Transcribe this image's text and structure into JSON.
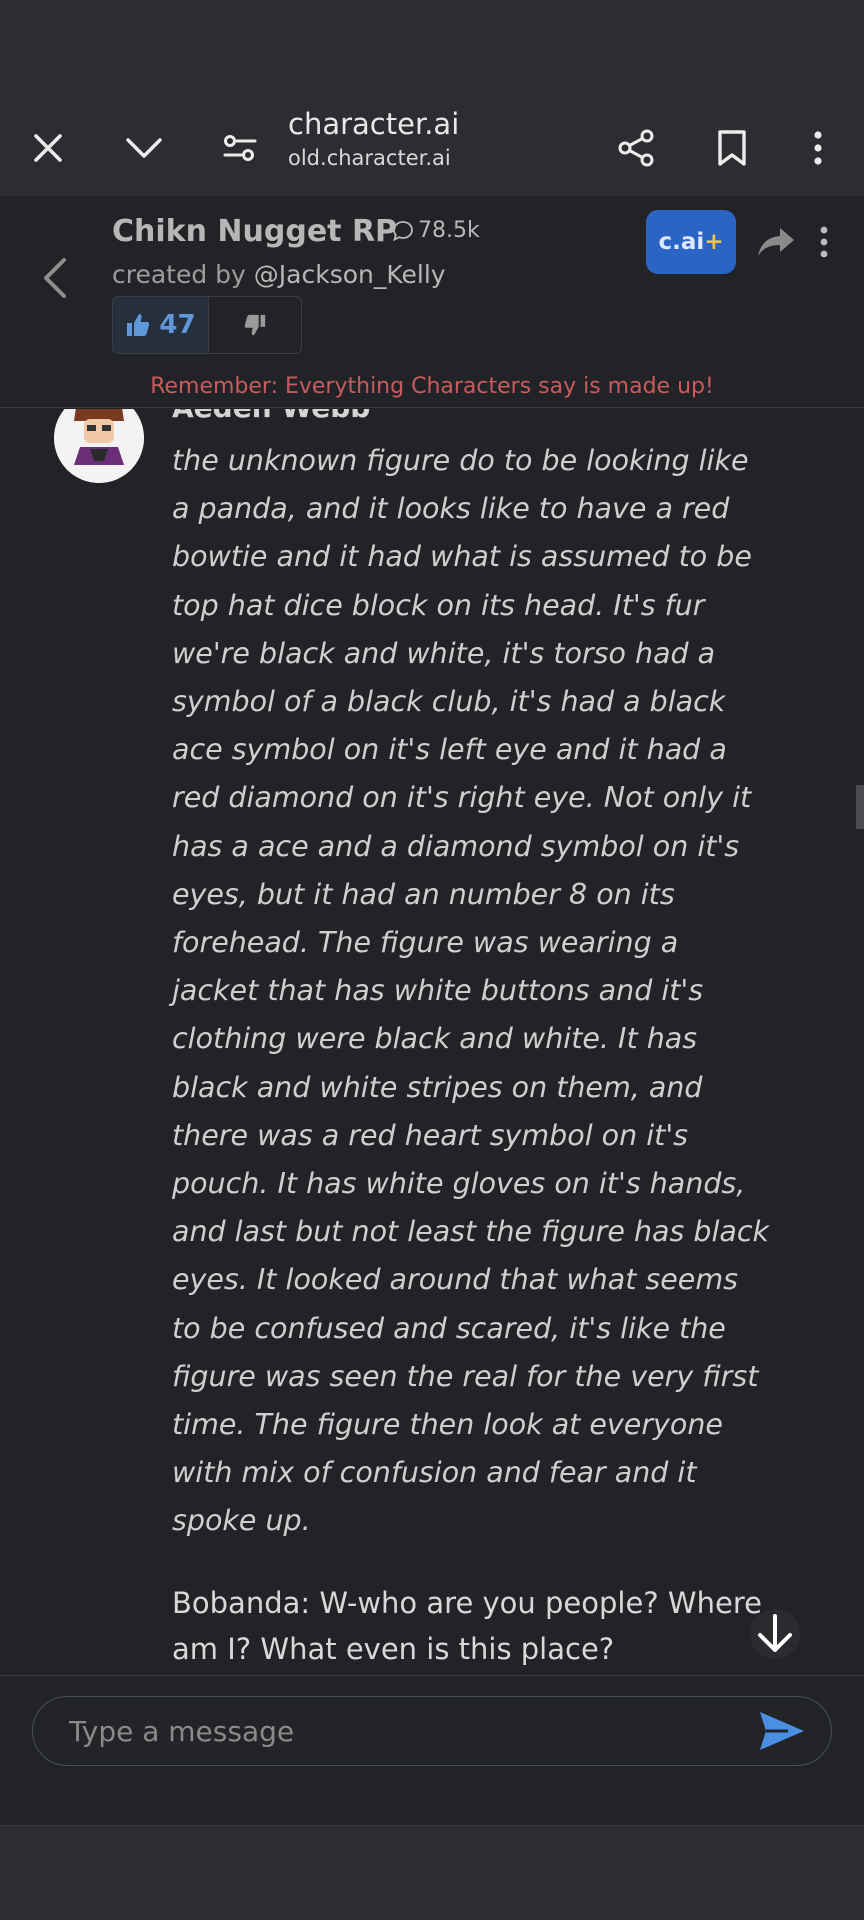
{
  "browser": {
    "title": "character.ai",
    "url": "old.character.ai",
    "icons": [
      "close-icon",
      "chevron-down-icon",
      "page-settings-icon",
      "share-icon",
      "bookmark-icon",
      "more-vert-icon"
    ]
  },
  "character": {
    "name": "Chikn Nugget RP",
    "chat_count": "78.5k",
    "created_by_prefix": "created by ",
    "creator_handle": "@Jackson_Kelly",
    "likes": "47",
    "cai_plus_label": "c.ai",
    "cai_plus_suffix": "+"
  },
  "disclaimer": "Remember: Everything Characters say is made up!",
  "message": {
    "sender": "Aeden Webb",
    "italic_text": "the unknown figure do to be looking like a panda, and it looks like to have a red bowtie and it had what is assumed to be top hat dice block on its head. It's fur we're black and white, it's torso had a symbol of a black club, it's had a black ace symbol on it's left eye and it had a red diamond on it's right eye. Not only it has a ace and a diamond symbol on it's eyes, but it had an number 8 on its forehead. The figure was wearing a jacket that has white buttons and it's clothing were black and white. It has black and white stripes on them, and there was a red heart symbol on it's pouch. It has white gloves on it's hands, and last but not least the figure has black eyes. It looked around that what seems to be confused and scared, it's like the figure was seen the real for the very first time. The figure then look at everyone with mix of confusion and fear and it spoke up.",
    "plain_text": "Bobanda: W-who are you people? Where am I? What even is this place?"
  },
  "input": {
    "placeholder": "Type a message"
  },
  "colors": {
    "background": "#222326",
    "bar": "#2c2d31",
    "accent_blue": "#2a64c4",
    "disclaimer_red": "#c85b5e",
    "like_blue": "#5f97d8"
  }
}
